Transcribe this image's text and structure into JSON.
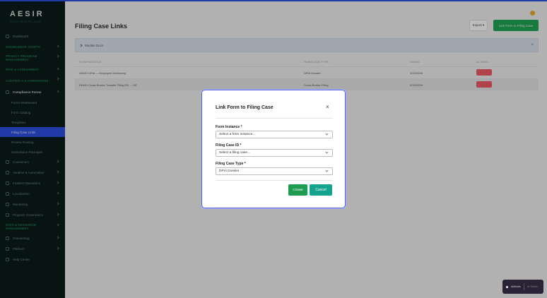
{
  "sidebar": {
    "brand": "AESIR",
    "tagline": "CONTROLPLANE",
    "items": [
      {
        "label": "Dashboard",
        "type": "item",
        "chev": false
      },
      {
        "label": "KNOWLEDGE ASSETS",
        "type": "grp",
        "chev": true
      },
      {
        "label": "PRIVACY PROGRAM MANAGEMENT",
        "type": "grp two",
        "chev": true
      },
      {
        "label": "RISK & ASSESSMENT",
        "type": "grp",
        "chev": true
      },
      {
        "label": "CONTROLS & OPERATIONS",
        "type": "grp two",
        "chev": true
      },
      {
        "label": "Compliance Forms",
        "type": "item open",
        "chev": true
      },
      {
        "label": "Forms Dashboard",
        "type": "sub",
        "chev": false
      },
      {
        "label": "Form Catalog",
        "type": "sub",
        "chev": false
      },
      {
        "label": "Templates",
        "type": "sub",
        "chev": false
      },
      {
        "label": "Filing Case Links",
        "type": "sub active",
        "chev": false
      },
      {
        "label": "Review Routing",
        "type": "sub",
        "chev": false
      },
      {
        "label": "Submission Packages",
        "type": "sub",
        "chev": false
      },
      {
        "label": "Consumers",
        "type": "item",
        "chev": true
      },
      {
        "label": "Vendors & Automation",
        "type": "item",
        "chev": true
      },
      {
        "label": "Incident Operations",
        "type": "item",
        "chev": true
      },
      {
        "label": "Localization",
        "type": "item",
        "chev": true
      },
      {
        "label": "Monitoring",
        "type": "item",
        "chev": true
      },
      {
        "label": "Program Governance",
        "type": "item",
        "chev": true
      },
      {
        "label": "DATA & RESOURCE MANAGEMENT",
        "type": "grp two",
        "chev": true
      },
      {
        "label": "Onboarding",
        "type": "item",
        "chev": true
      },
      {
        "label": "Platform",
        "type": "item",
        "chev": true
      },
      {
        "label": "Help Center",
        "type": "item",
        "chev": false
      }
    ]
  },
  "header": {
    "title": "Filing Case Links",
    "export_label": "Export ▾",
    "link_label": "Link Form to Filing Case"
  },
  "section": {
    "label": "Module Docs"
  },
  "table": {
    "headers": [
      "Form Instance",
      "Filing Case Type",
      "Linked",
      "Actions"
    ],
    "rows": [
      [
        "DEMO DPIA — Employee Monitoring",
        "DPIA Dossier",
        "4/22/2026"
      ],
      [
        "DEMO Cross-Border Transfer Filing EN → DE",
        "Cross-Border Filing",
        "9/20/2026"
      ]
    ]
  },
  "modal": {
    "title": "Link Form to Filing Case",
    "close": "×",
    "fields": [
      {
        "label": "Form Instance *",
        "value": "Select a form instance..."
      },
      {
        "label": "Filing Case ID *",
        "value": "Select a filing case..."
      },
      {
        "label": "Filing Case Type *",
        "value": "DPIA Dossier"
      }
    ],
    "create_label": "Create",
    "cancel_label": "Cancel"
  },
  "toast": {
    "primary": "Actihubs",
    "secondary": "UI Studio"
  },
  "colors": {
    "accent": "#2c49d8",
    "primary_green": "#1f9c51",
    "teal": "#16a38e",
    "danger": "#e05561"
  }
}
